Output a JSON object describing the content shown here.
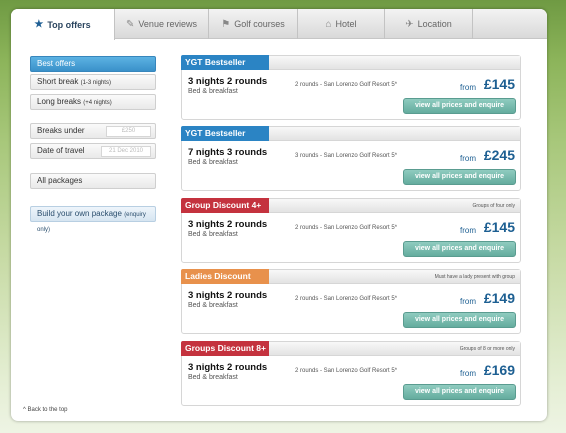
{
  "tabs": [
    {
      "label": "Top offers",
      "icon": "star-icon"
    },
    {
      "label": "Venue reviews",
      "icon": "pencil-icon"
    },
    {
      "label": "Golf courses",
      "icon": "flag-icon"
    },
    {
      "label": "Hotel",
      "icon": "house-icon"
    },
    {
      "label": "Location",
      "icon": "plane-icon"
    }
  ],
  "sidebar": {
    "best_offers": "Best offers",
    "short_break": "Short break",
    "short_break_note": "(1-3 nights)",
    "long_breaks": "Long breaks",
    "long_breaks_note": "(+4 nights)",
    "breaks_under": "Breaks under",
    "breaks_under_value": "£250",
    "date_of_travel": "Date of travel",
    "date_value": "21 Dec 2010",
    "all_packages": "All packages",
    "build_package": "Build your own package",
    "build_package_note": "(enquiry only)",
    "back_to_top": "^ Back to the top"
  },
  "offers": [
    {
      "badge": "YGT Bestseller",
      "badge_color": "#2b84c4",
      "note": "",
      "title": "3 nights 2 rounds",
      "board": "Bed & breakfast",
      "desc": "2 rounds - San Lorenzo Golf Resort 5*",
      "from": "from",
      "price": "£145",
      "button": "view all prices and enquire"
    },
    {
      "badge": "YGT Bestseller",
      "badge_color": "#2b84c4",
      "note": "",
      "title": "7 nights 3 rounds",
      "board": "Bed & breakfast",
      "desc": "3 rounds - San Lorenzo Golf Resort 5*",
      "from": "from",
      "price": "£245",
      "button": "view all prices and enquire"
    },
    {
      "badge": "Group Discount 4+",
      "badge_color": "#c4323e",
      "note": "Groups of four only",
      "title": "3 nights 2 rounds",
      "board": "Bed & breakfast",
      "desc": "2 rounds - San Lorenzo Golf Resort 5*",
      "from": "from",
      "price": "£145",
      "button": "view all prices and enquire"
    },
    {
      "badge": "Ladies Discount",
      "badge_color": "#e8914c",
      "note": "Must have a lady present with group",
      "title": "3 nights 2 rounds",
      "board": "Bed & breakfast",
      "desc": "2 rounds - San Lorenzo Golf Resort 5*",
      "from": "from",
      "price": "£149",
      "button": "view all prices and enquire"
    },
    {
      "badge": "Groups Discount 8+",
      "badge_color": "#c4323e",
      "note": "Groups of 8 or more only",
      "title": "3 nights 2 rounds",
      "board": "Bed & breakfast",
      "desc": "2 rounds - San Lorenzo Golf Resort 5*",
      "from": "from",
      "price": "£169",
      "button": "view all prices and enquire"
    }
  ]
}
